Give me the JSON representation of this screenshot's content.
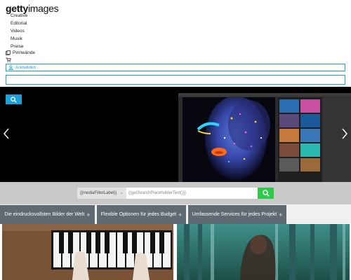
{
  "brand": {
    "logo_bold": "getty",
    "logo_light": "images"
  },
  "nav": {
    "items": [
      "Creative",
      "Editorial",
      "Videos",
      "Musik",
      "Preise"
    ]
  },
  "utility": {
    "boards_label": "Pinnwände",
    "cart_icon": "cart-icon",
    "login_label": "Anmelden"
  },
  "search": {
    "value": "",
    "button_icon": "search-icon"
  },
  "hero": {
    "prev_icon": "chevron-left-icon",
    "next_icon": "chevron-right-icon"
  },
  "search_band": {
    "filter_label": "{{mediaFilterLabel}}",
    "placeholder": "{{getSearchPlaceholderText()}}",
    "button_color": "#2ec84a"
  },
  "features": [
    {
      "label": "Die eindrucksvollsten Bilder der Welt"
    },
    {
      "label": "Flexible Optionen für jedes Budget"
    },
    {
      "label": "Umfassende Services für jedes Projekt"
    }
  ],
  "colors": {
    "accent": "#1ea0d8",
    "band": "#c9c9c9",
    "feature_bg": "#606a73"
  }
}
